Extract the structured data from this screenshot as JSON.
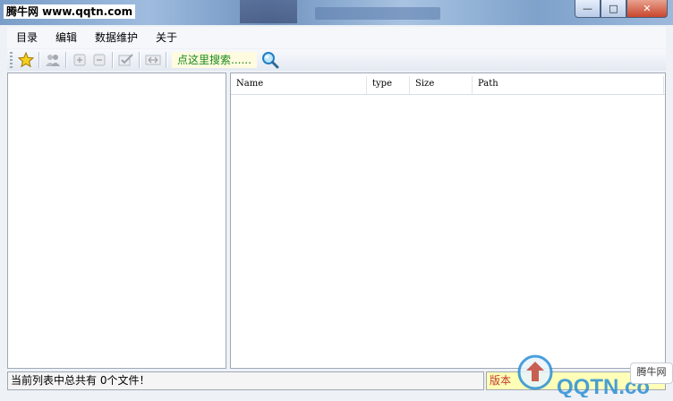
{
  "window": {
    "title": "腾牛网 www.qqtn.com",
    "controls": {
      "minimize": "—",
      "maximize": "□",
      "close": "✕"
    }
  },
  "menubar": {
    "items": [
      {
        "label": "目录"
      },
      {
        "label": "编辑"
      },
      {
        "label": "数据维护"
      },
      {
        "label": "关于"
      }
    ]
  },
  "toolbar": {
    "search_hint": "点这里搜索......",
    "icons": [
      "star-icon",
      "users-icon",
      "add-icon",
      "remove-icon",
      "check-icon",
      "swap-icon",
      "search-icon"
    ]
  },
  "file_list": {
    "columns": [
      {
        "label": "Name"
      },
      {
        "label": "type"
      },
      {
        "label": "Size"
      },
      {
        "label": "Path"
      }
    ],
    "rows": []
  },
  "statusbar": {
    "message": "当前列表中总共有 0个文件！",
    "version_label": "版本"
  },
  "watermark": {
    "logo_text": "QQTN.com",
    "badge_text": "腾牛网"
  },
  "colors": {
    "search_hint_text": "#1a8a1a",
    "version_text": "#c0392b",
    "watermark_blue": "#2a8fd6"
  }
}
